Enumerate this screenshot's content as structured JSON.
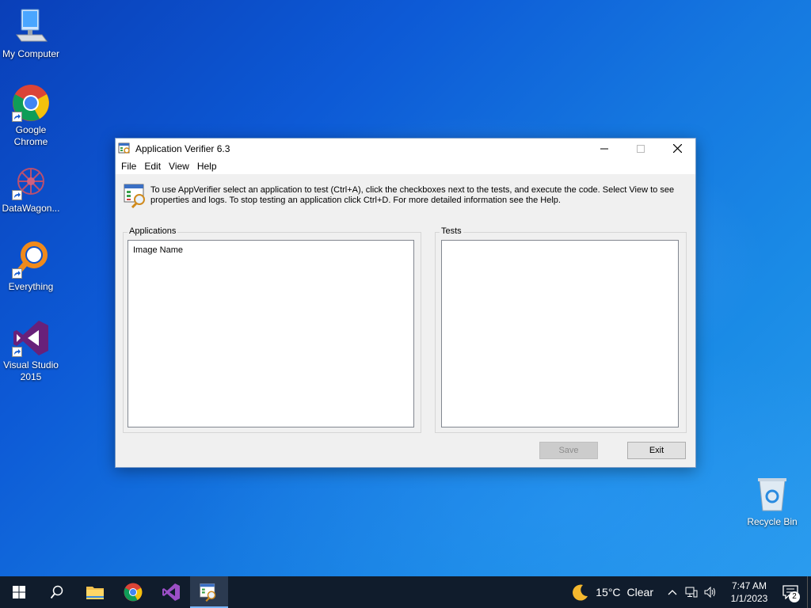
{
  "desktop": {
    "icons": [
      {
        "label": "My Computer"
      },
      {
        "label": "Google Chrome"
      },
      {
        "label": "DataWagon..."
      },
      {
        "label": "Everything"
      },
      {
        "label": "Visual Studio 2015"
      },
      {
        "label": "Recycle Bin"
      }
    ]
  },
  "window": {
    "title": "Application Verifier 6.3",
    "menu": [
      "File",
      "Edit",
      "View",
      "Help"
    ],
    "info_text": "To use AppVerifier select an application to test (Ctrl+A), click the checkboxes next to the tests, and execute the code. Select View to see properties and logs. To stop testing an application click Ctrl+D. For more detailed information see the Help.",
    "applications": {
      "legend": "Applications",
      "column_header": "Image Name"
    },
    "tests": {
      "legend": "Tests"
    },
    "save_label": "Save",
    "exit_label": "Exit"
  },
  "taskbar": {
    "weather": {
      "temp": "15°C",
      "condition": "Clear"
    },
    "clock": {
      "time": "7:47 AM",
      "date": "1/1/2023"
    },
    "notification_count": "2"
  }
}
